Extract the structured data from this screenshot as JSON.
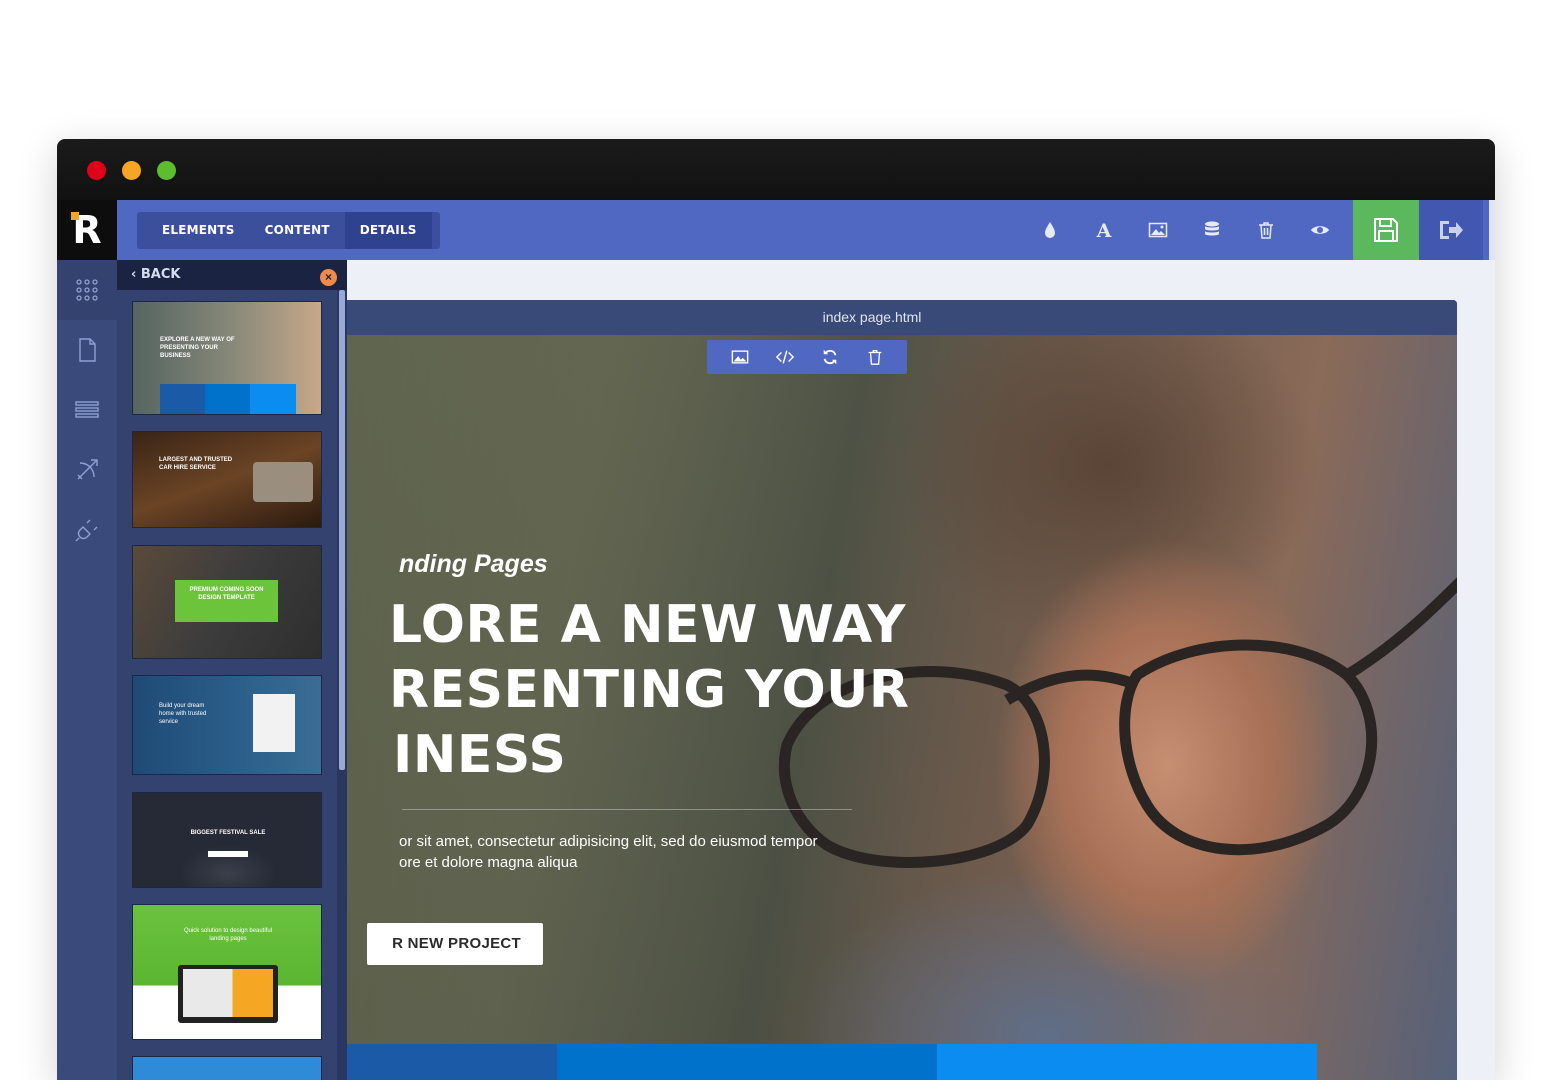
{
  "window": {
    "traffic_lights": [
      "close",
      "minimize",
      "zoom"
    ]
  },
  "logo": {
    "letter": "R"
  },
  "rail": {
    "items": [
      "grid-icon",
      "page-icon",
      "list-icon",
      "bow-arrow-icon",
      "plug-icon"
    ]
  },
  "toolbar": {
    "tabs": [
      {
        "label": "ELEMENTS"
      },
      {
        "label": "CONTENT"
      },
      {
        "label": "DETAILS"
      }
    ],
    "tools": [
      "drop-icon",
      "font-icon",
      "image-icon",
      "database-icon",
      "trash-icon",
      "eye-icon",
      "cube-icon"
    ],
    "save_icon": "floppy-icon",
    "exit_icon": "sign-out-icon",
    "accent_color": "#5068c2",
    "save_color": "#5cb85c"
  },
  "panel": {
    "back_label": "BACK",
    "thumbnails": [
      {
        "title": "EXPLORE A NEW WAY OF PRESENTING YOUR BUSINESS"
      },
      {
        "title": "LARGEST AND TRUSTED CAR HIRE SERVICE"
      },
      {
        "title": "PREMIUM COMING SOON DESIGN TEMPLATE"
      },
      {
        "title": "Build your dream home with trusted service"
      },
      {
        "title": "BIGGEST FESTIVAL SALE"
      },
      {
        "title": "Quick solution to design beautiful landing pages"
      },
      {
        "title": ""
      }
    ]
  },
  "canvas": {
    "file_name": "index page.html",
    "block_tools": [
      "image-icon",
      "code-icon",
      "refresh-icon",
      "trash-icon"
    ],
    "hero": {
      "subtitle": "nding Pages",
      "title_lines": [
        "LORE A NEW WAY",
        "RESENTING YOUR",
        "INESS"
      ],
      "body_lines": [
        "or sit amet, consectetur adipisicing elit, sed do eiusmod tempor",
        "ore et dolore magna aliqua"
      ],
      "button_label": "R NEW PROJECT"
    },
    "strip_colors": [
      "#1a5aa6",
      "#0072cc",
      "#0a8cf0"
    ]
  }
}
